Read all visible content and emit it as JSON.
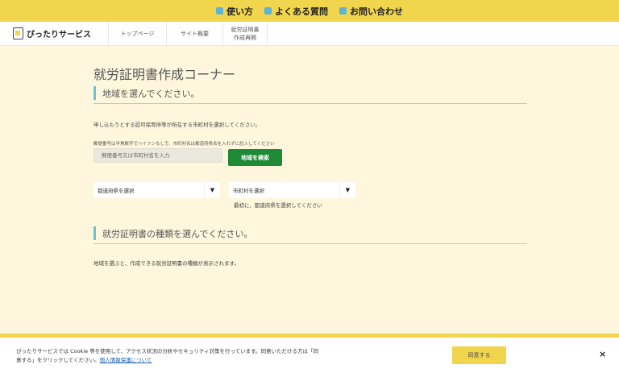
{
  "topbar": {
    "items": [
      {
        "icon": "info-square-icon",
        "label": "使い方"
      },
      {
        "icon": "info-square-icon",
        "label": "よくある質問"
      },
      {
        "icon": "info-square-icon",
        "label": "お問い合わせ"
      }
    ]
  },
  "nav": {
    "logo_text": "ぴったりサービス",
    "items": [
      {
        "label": "トップページ"
      },
      {
        "label": "サイト概要"
      },
      {
        "label_line1": "就労証明書",
        "label_line2": "作成再開"
      }
    ]
  },
  "main": {
    "page_title": "就労証明書作成コーナー",
    "section1": {
      "heading": "地域を選んでください。",
      "description": "申し込もうとする認可保育所等が所在する市町村を選択してください。",
      "hint": "郵便番号は半角数字でハイフンなしで、市町村名は都道府県名を入れずに記入してください",
      "search_placeholder": "郵便番号又は市町村名を入力",
      "search_button": "地域を検索",
      "prefecture_select": "都道府県を選択",
      "city_select": "市町村を選択",
      "city_note": "最初に、都道府県を選択してください",
      "dropdown_arrow": "▼"
    },
    "section2": {
      "heading": "就労証明書の種類を選んでください。",
      "description": "地域を選ぶと、作成できる就労証明書の種類が表示されます。"
    }
  },
  "cookie_banner": {
    "text_line1": "ぴったりサービスでは Cookie 等を使用して、アクセス状況の分析やセキュリティ対策を行っています。同意いただける方は「同",
    "text_line2": "意する」をクリックしてください。",
    "link_text": "個人情報保護について",
    "agree_button": "同意する",
    "close_symbol": "×"
  },
  "colors": {
    "brand_yellow": "#f1d64d",
    "page_background": "#fef7dd",
    "accent_blue": "#6cc2db",
    "search_button_green": "#1e8a36"
  }
}
